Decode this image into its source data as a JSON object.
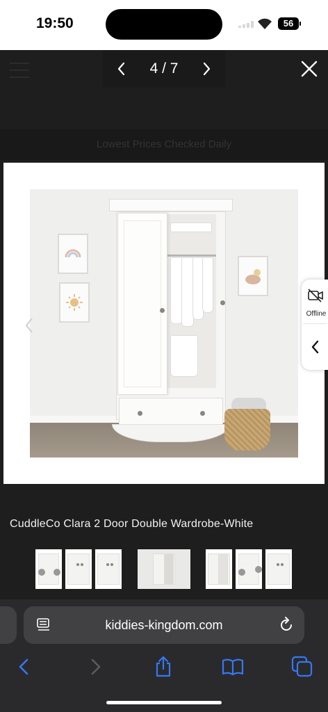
{
  "status_bar": {
    "time": "19:50",
    "battery": "56",
    "icons": [
      "signal-icon",
      "wifi-icon",
      "battery-icon"
    ]
  },
  "background_page": {
    "banner_text": "Lowest Prices Checked Daily"
  },
  "gallery": {
    "counter": "4 / 7",
    "icons": [
      "chevron-left-icon",
      "chevron-right-icon",
      "close-icon"
    ],
    "main_image_alt": "CuddleCo Clara 2 Door Double Wardrobe-White",
    "thumbnail_count": 7
  },
  "side_widget": {
    "offline_label": "Offline",
    "icons": [
      "video-off-icon",
      "chevron-left-icon"
    ]
  },
  "product": {
    "title": "CuddleCo Clara 2 Door Double Wardrobe-White"
  },
  "browser": {
    "url": "kiddies-kingdom.com",
    "icons": [
      "reader-icon",
      "reload-icon",
      "back-icon",
      "forward-icon",
      "share-icon",
      "bookmarks-icon",
      "tabs-icon"
    ],
    "accent_color": "#3478f6",
    "disabled_color": "#5b5b5e"
  }
}
